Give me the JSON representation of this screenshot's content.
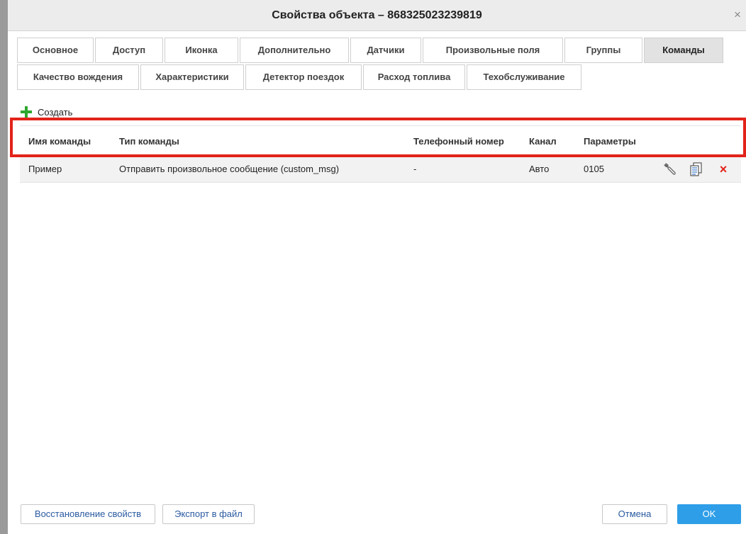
{
  "window": {
    "title": "Свойства объекта – 868325023239819",
    "close_symbol": "×"
  },
  "tabs": [
    {
      "label": "Основное"
    },
    {
      "label": "Доступ"
    },
    {
      "label": "Иконка"
    },
    {
      "label": "Дополнительно"
    },
    {
      "label": "Датчики"
    },
    {
      "label": "Произвольные поля"
    },
    {
      "label": "Группы"
    },
    {
      "label": "Команды",
      "active": true
    },
    {
      "label": "Качество вождения"
    },
    {
      "label": "Характеристики"
    },
    {
      "label": "Детектор поездок"
    },
    {
      "label": "Расход топлива"
    },
    {
      "label": "Техобслуживание"
    }
  ],
  "toolbar": {
    "create_label": "Создать",
    "create_icon": "plus-icon",
    "create_icon_color": "#2ea82e"
  },
  "table": {
    "columns": [
      "Имя команды",
      "Тип команды",
      "Телефонный номер",
      "Канал",
      "Параметры"
    ],
    "rows": [
      {
        "name": "Пример",
        "type": "Отправить произвольное сообщение (custom_msg)",
        "phone": "-",
        "channel": "Авто",
        "params": "0105",
        "actions": [
          "wrench-icon",
          "copy-icon",
          "delete-icon"
        ],
        "delete_symbol": "×"
      }
    ]
  },
  "footer": {
    "restore_label": "Восстановление свойств",
    "export_label": "Экспорт в файл",
    "cancel_label": "Отмена",
    "ok_label": "OK"
  },
  "colors": {
    "highlight": "#e2231a",
    "primary_button": "#2e9ee8",
    "delete_icon": "#e2231a"
  }
}
